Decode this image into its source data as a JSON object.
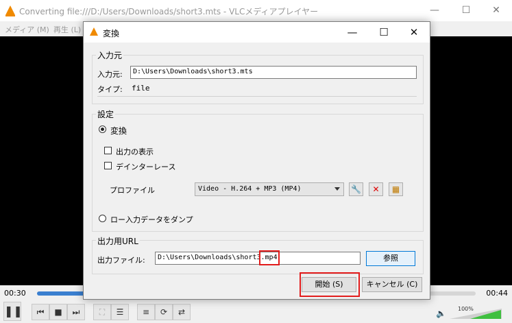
{
  "vlc": {
    "title": "Converting file:///D:/Users/Downloads/short3.mts - VLCメディアプレイヤー",
    "menu": [
      "メディア (M)",
      "再生 (L)"
    ],
    "time_elapsed": "00:30",
    "time_total": "00:44",
    "progress_fraction": 0.68,
    "volume": "100%"
  },
  "dialog": {
    "title": "変換",
    "source": {
      "group_title": "入力元",
      "input_label": "入力元:",
      "input_value": "D:\\Users\\Downloads\\short3.mts",
      "type_label": "タイプ:",
      "type_value": "file"
    },
    "settings": {
      "group_title": "設定",
      "convert_label": "変換",
      "show_output_label": "出力の表示",
      "deinterlace_label": "デインターレース",
      "profile_label": "プロファイル",
      "profile_value": "Video - H.264 + MP3 (MP4)",
      "dump_label": "ロー入力データをダンプ"
    },
    "destination": {
      "group_title": "出力用URL",
      "file_label": "出力ファイル:",
      "file_value_main": "D:\\Users\\Downloads\\short3",
      "file_value_ext": ".mp4",
      "browse_label": "参照"
    },
    "buttons": {
      "start": "開始 (S)",
      "cancel": "キャンセル (C)"
    }
  }
}
